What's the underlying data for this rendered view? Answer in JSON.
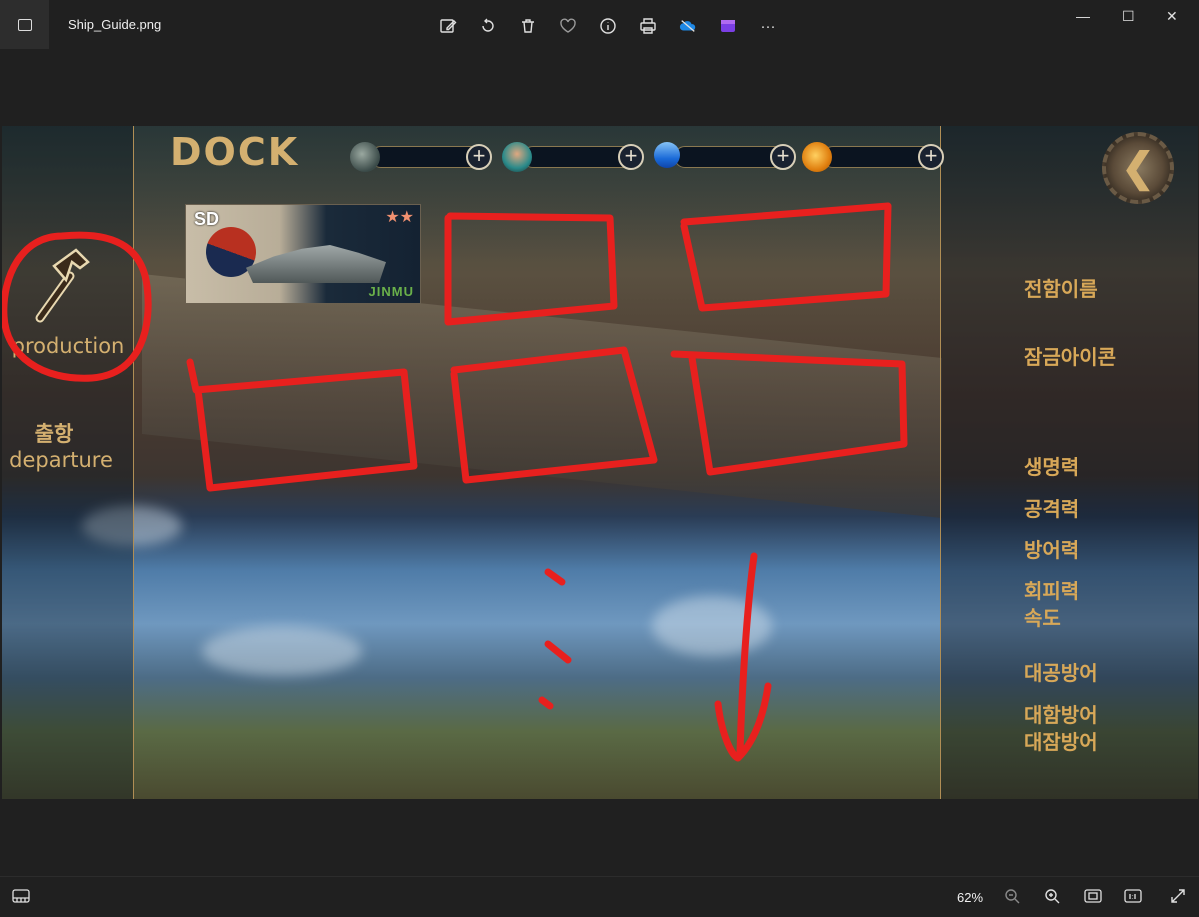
{
  "window": {
    "filename": "Ship_Guide.png",
    "minimize": "—",
    "maximize": "☐",
    "close": "✕"
  },
  "toolbar": {
    "more": "···"
  },
  "game": {
    "title": "DOCK",
    "back_icon": "❮",
    "ship_card": {
      "grade": "SD",
      "stars": "★★",
      "name": "JINMU"
    },
    "left_menu": {
      "production": "production",
      "departure_kr": "출항",
      "departure_en": "departure"
    },
    "stats": {
      "ship_name": "전함이름",
      "lock_icon": "잠금아이콘",
      "hp": "생명력",
      "attack": "공격력",
      "defense": "방어력",
      "evasion": "회피력",
      "speed": "속도",
      "anti_air": "대공방어",
      "anti_ship": "대함방어",
      "anti_sub": "대잠방어"
    },
    "colors": {
      "gold": "#d4b070",
      "annotation_red": "#e8201e"
    }
  },
  "statusbar": {
    "zoom": "62%"
  }
}
